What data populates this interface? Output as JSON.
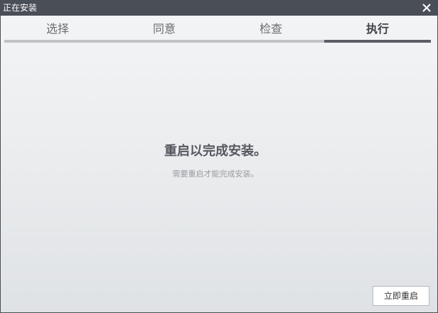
{
  "window": {
    "title": "正在安装"
  },
  "steps": [
    {
      "label": "选择"
    },
    {
      "label": "同意"
    },
    {
      "label": "检查"
    },
    {
      "label": "执行",
      "active": true
    }
  ],
  "progress": {
    "completed_fraction": 0.75
  },
  "message": {
    "headline": "重启以完成安装。",
    "detail": "需要重启才能完成安装。"
  },
  "buttons": {
    "restart_label": "立即重启"
  },
  "icons": {
    "close": "close-icon"
  },
  "colors": {
    "titlebar": "#4a4e57",
    "active_step": "#3e4147",
    "progress_track": "#c0c2c5",
    "progress_fill": "#5a5d63"
  }
}
